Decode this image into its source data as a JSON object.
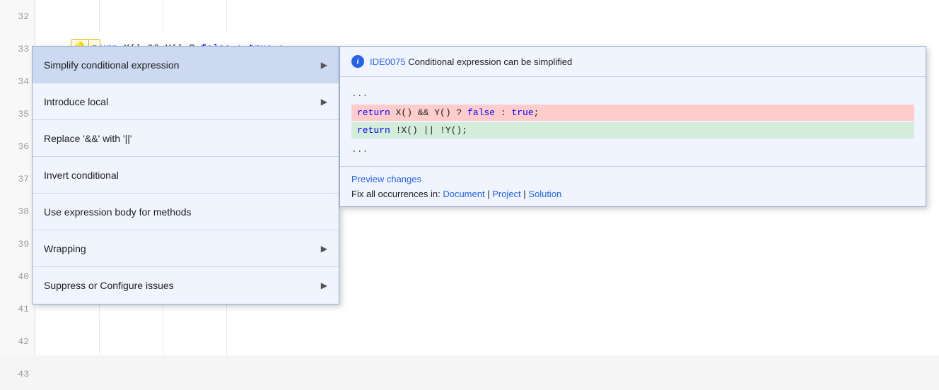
{
  "editor": {
    "lines": [
      {
        "number": "32",
        "content": ""
      },
      {
        "number": "33",
        "content": "return X() && Y() ? false : true;"
      },
      {
        "number": "34",
        "content": ""
      },
      {
        "number": "35",
        "content": ""
      },
      {
        "number": "36",
        "content": ""
      },
      {
        "number": "37",
        "content": ""
      },
      {
        "number": "38",
        "content": ""
      },
      {
        "number": "39",
        "content": ""
      },
      {
        "number": "40",
        "content": ""
      },
      {
        "number": "41",
        "content": ""
      },
      {
        "number": "42",
        "content": ""
      },
      {
        "number": "43",
        "content": ""
      }
    ]
  },
  "lightbulb": {
    "icon": "💡",
    "dropdown_arrow": "▼"
  },
  "context_menu": {
    "items": [
      {
        "label": "Simplify conditional expression",
        "has_arrow": true,
        "selected": true
      },
      {
        "label": "Introduce local",
        "has_arrow": true,
        "selected": false
      },
      {
        "label": "Replace '&&' with '||'",
        "has_arrow": false,
        "selected": false
      },
      {
        "label": "Invert conditional",
        "has_arrow": false,
        "selected": false
      },
      {
        "label": "Use expression body for methods",
        "has_arrow": false,
        "selected": false
      },
      {
        "label": "Wrapping",
        "has_arrow": true,
        "selected": false
      },
      {
        "label": "Suppress or Configure issues",
        "has_arrow": true,
        "selected": false
      }
    ]
  },
  "preview_panel": {
    "header": {
      "ide_code": "IDE0075",
      "title": " Conditional expression can be simplified"
    },
    "code_dots_top": "...",
    "code_removed": "return X() && Y() ? false : true;",
    "code_added": "return !X() || !Y();",
    "code_dots_bottom": "...",
    "footer": {
      "preview_changes_label": "Preview changes",
      "fix_all_prefix": "Fix all occurrences in: ",
      "fix_document": "Document",
      "fix_separator1": " | ",
      "fix_project": "Project",
      "fix_separator2": " | ",
      "fix_solution": "Solution"
    }
  }
}
